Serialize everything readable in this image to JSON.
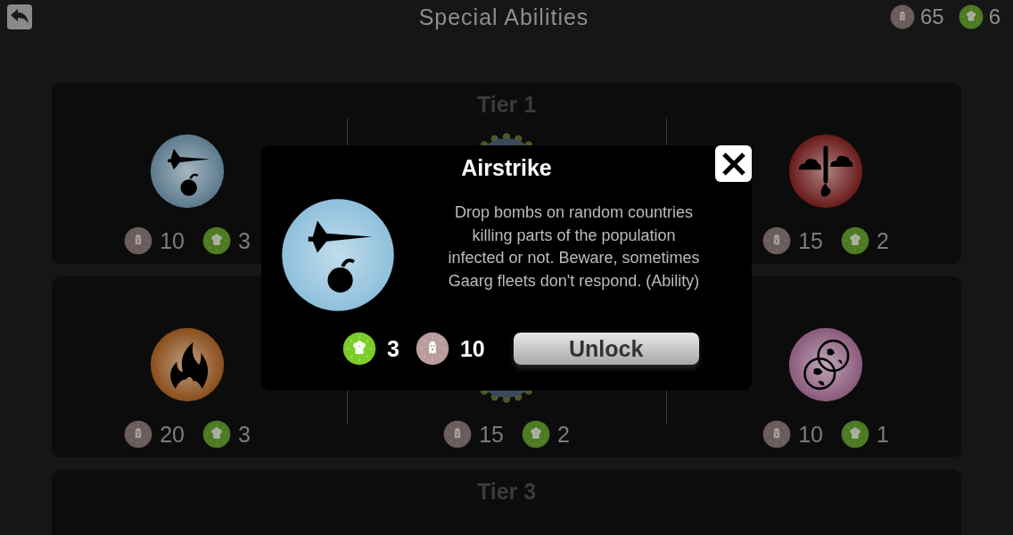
{
  "header": {
    "title": "Special Abilities",
    "currencies": [
      {
        "kind": "ghost",
        "amount": "65"
      },
      {
        "kind": "germ",
        "amount": "6"
      }
    ]
  },
  "tiers": [
    {
      "label": "Tier 1",
      "abilities": [
        {
          "kind": "airstrike",
          "color": "#5b7a8c",
          "costs": [
            {
              "kind": "ghost",
              "amount": "10"
            },
            {
              "kind": "germ",
              "amount": "3"
            }
          ]
        },
        {
          "kind": "ringed"
        },
        {
          "kind": "meteor",
          "color": "#6a1a1a",
          "costs": [
            {
              "kind": "ghost",
              "amount": "15"
            },
            {
              "kind": "germ",
              "amount": "2"
            }
          ]
        }
      ]
    },
    {
      "abilities": [
        {
          "kind": "fire",
          "color": "#8a4e1c",
          "costs": [
            {
              "kind": "ghost",
              "amount": "20"
            },
            {
              "kind": "germ",
              "amount": "3"
            }
          ]
        },
        {
          "kind": "ringed",
          "costs": [
            {
              "kind": "ghost",
              "amount": "15"
            },
            {
              "kind": "germ",
              "amount": "2"
            }
          ]
        },
        {
          "kind": "globes",
          "color": "#8a5a7c",
          "costs": [
            {
              "kind": "ghost",
              "amount": "10"
            },
            {
              "kind": "germ",
              "amount": "1"
            }
          ]
        }
      ]
    },
    {
      "label": "Tier 3"
    }
  ],
  "modal": {
    "title": "Airstrike",
    "icon": {
      "kind": "airstrike",
      "color": "#8fc0dc"
    },
    "description": "Drop bombs on random countries killing parts of the population infected or not. Beware, sometimes Gaarg fleets don't respond. (Ability)",
    "costs": [
      {
        "kind": "germ",
        "amount": "3"
      },
      {
        "kind": "ghost",
        "amount": "10"
      }
    ],
    "button": "Unlock"
  }
}
